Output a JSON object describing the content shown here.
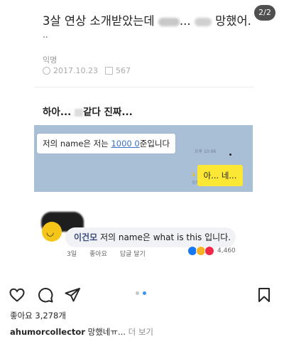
{
  "post": {
    "page_indicator": "2/2",
    "article": {
      "title_start": "3살 연상 소개받았는데",
      "title_mid": "...",
      "title_end": "망했어.",
      "title_dots": "..",
      "author": "익명",
      "date": "2017.10.23",
      "views": "567",
      "body": "하아...",
      "body_end": "같다 진짜..."
    },
    "chat": {
      "incoming_before": "저의 name은 저는 ",
      "incoming_link": "1000 0",
      "incoming_after": "준입니다",
      "incoming_time": "오후 10:06",
      "read_marker": "1",
      "outgoing_time": "오후 10:06",
      "outgoing": "아... 네..."
    },
    "comment": {
      "name": "이건모",
      "text": " 저의 name은 what is this 입니다.",
      "age": "3일",
      "like_action": "좋아요",
      "reply_action": "답글 달기",
      "reaction_count": "4,460"
    }
  },
  "actions": {
    "like_icon": "heart-icon",
    "comment_icon": "comment-icon",
    "share_icon": "send-icon",
    "save_icon": "bookmark-icon"
  },
  "likes_text": "좋아요 3,278개",
  "caption": {
    "username": "ahumorcollector",
    "text": " 망했네ㅠ...",
    "more": " 더 보기"
  },
  "colors": {
    "chat_bg": "#a8bfd6",
    "yellow_bubble": "#fce734",
    "active_dot": "#3897f0"
  }
}
